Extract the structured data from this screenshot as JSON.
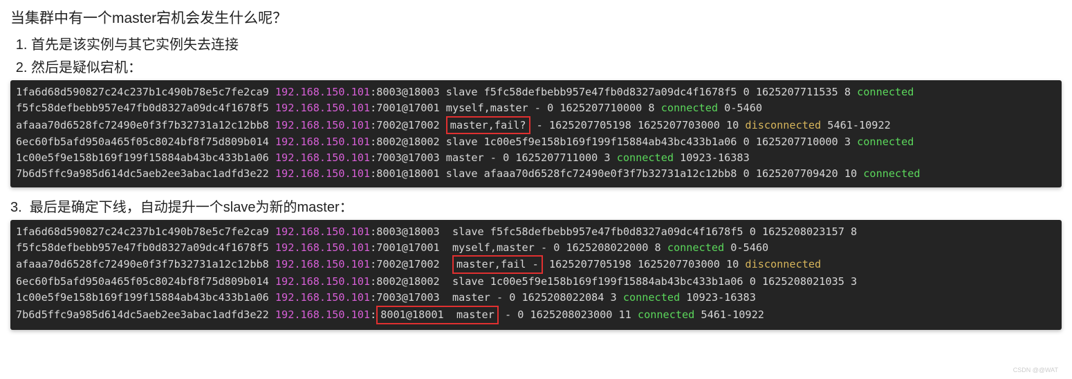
{
  "heading": "当集群中有一个master宕机会发生什么呢？",
  "steps": {
    "s1": "首先是该实例与其它实例失去连接",
    "s2": "然后是疑似宕机：",
    "s3": "最后是确定下线，自动提升一个slave为新的master："
  },
  "ip": "192.168.150.101",
  "term1": {
    "l1_id": "1fa6d68d590827c24c237b1c490b78e5c7fe2ca9",
    "l1_port": ":8003@18003",
    "l1_rest": " slave f5fc58defbebb957e47fb0d8327a09dc4f1678f5 0 1625207711535 8 ",
    "l2_id": "f5fc58defbebb957e47fb0d8327a09dc4f1678f5",
    "l2_port": ":7001@17001",
    "l2_rest": " myself,master - 0 1625207710000 8 ",
    "l2_slots": " 0-5460",
    "l3_id": "afaaa70d6528fc72490e0f3f7b32731a12c12bb8",
    "l3_port": ":7002@17002 ",
    "l3_box": "master,fail?",
    "l3_rest": " - 1625207705198 1625207703000 10 ",
    "l3_slots": " 5461-10922",
    "l4_id": "6ec60fb5afd950a465f05c8024bf8f75d809b014",
    "l4_port": ":8002@18002",
    "l4_rest": " slave 1c00e5f9e158b169f199f15884ab43bc433b1a06 0 1625207710000 3 ",
    "l5_id": "1c00e5f9e158b169f199f15884ab43bc433b1a06",
    "l5_port": ":7003@17003",
    "l5_rest": " master - 0 1625207711000 3 ",
    "l5_slots": " 10923-16383",
    "l6_id": "7b6d5ffc9a985d614dc5aeb2ee3abac1adfd3e22",
    "l6_port": ":8001@18001",
    "l6_rest": " slave afaaa70d6528fc72490e0f3f7b32731a12c12bb8 0 1625207709420 10 "
  },
  "term2": {
    "l1_id": "1fa6d68d590827c24c237b1c490b78e5c7fe2ca9",
    "l1_port": ":8003@18003",
    "l1_rest": "  slave f5fc58defbebb957e47fb0d8327a09dc4f1678f5 0 1625208023157 8",
    "l2_id": "f5fc58defbebb957e47fb0d8327a09dc4f1678f5",
    "l2_port": ":7001@17001",
    "l2_rest": "  myself,master - 0 1625208022000 8 ",
    "l2_slots": " 0-5460",
    "l3_id": "afaaa70d6528fc72490e0f3f7b32731a12c12bb8",
    "l3_port": ":7002@17002  ",
    "l3_box": "master,fail -",
    "l3_rest": " 1625207705198 1625207703000 10 ",
    "l4_id": "6ec60fb5afd950a465f05c8024bf8f75d809b014",
    "l4_port": ":8002@18002",
    "l4_rest": "  slave 1c00e5f9e158b169f199f15884ab43bc433b1a06 0 1625208021035 3",
    "l5_id": "1c00e5f9e158b169f199f15884ab43bc433b1a06",
    "l5_port": ":7003@17003",
    "l5_rest": "  master - 0 1625208022084 3 ",
    "l5_slots": " 10923-16383",
    "l6_id": "7b6d5ffc9a985d614dc5aeb2ee3abac1adfd3e22",
    "l6_port": ":",
    "l6_box": "8001@18001  master",
    "l6_rest": " - 0 1625208023000 11 ",
    "l6_slots": " 5461-10922"
  },
  "status": {
    "connected": "connected",
    "disconnected": "disconnected"
  },
  "watermark": "CSDN @@WAT"
}
